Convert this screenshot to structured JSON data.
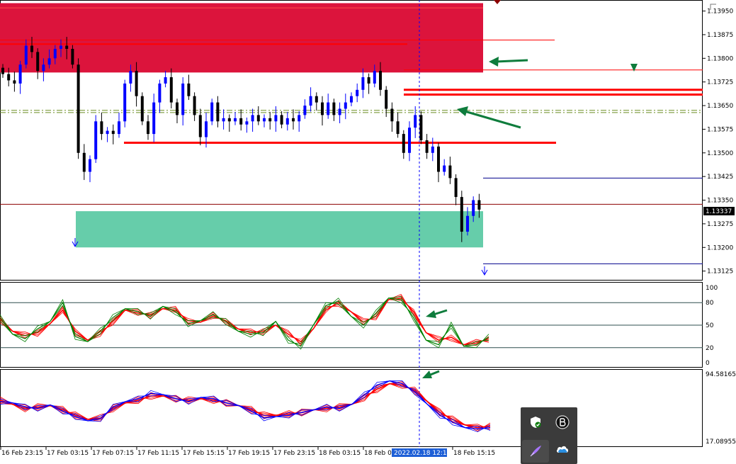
{
  "chart_data": [
    {
      "type": "candlestick",
      "title": "",
      "ylim": [
        1.13095,
        1.13985
      ],
      "yticks": [
        "1.13950",
        "1.13875",
        "1.13800",
        "1.13725",
        "1.13650",
        "1.13575",
        "1.13500",
        "1.13425",
        "1.13350",
        "1.13275",
        "1.13200",
        "1.13125"
      ],
      "current_price": "1.13337",
      "current_value": 1.13337,
      "zones": [
        {
          "name": "supply",
          "color": "#dc143c",
          "y1": 1.13755,
          "y2": 1.13975
        },
        {
          "name": "demand",
          "color": "#66cdaa",
          "y1": 1.132,
          "y2": 1.13315
        }
      ],
      "levels": [
        1.13532,
        1.137,
        1.13685,
        1.13763,
        1.13858,
        1.13635,
        1.13628,
        1.1342,
        1.13148,
        1.13337
      ],
      "close_path": [
        1.1375,
        1.1373,
        1.1372,
        1.1378,
        1.1384,
        1.1382,
        1.1376,
        1.1378,
        1.138,
        1.1383,
        1.1384,
        1.1383,
        1.1378,
        1.135,
        1.1344,
        1.1348,
        1.136,
        1.1356,
        1.1357,
        1.1356,
        1.136,
        1.1372,
        1.1376,
        1.1368,
        1.136,
        1.1356,
        1.1366,
        1.1372,
        1.1374,
        1.1366,
        1.1362,
        1.1372,
        1.1368,
        1.1362,
        1.1355,
        1.136,
        1.1366,
        1.136,
        1.1361,
        1.136,
        1.1361,
        1.1359,
        1.136,
        1.1362,
        1.136,
        1.1361,
        1.136,
        1.1362,
        1.1359,
        1.1361,
        1.136,
        1.1362,
        1.1365,
        1.1368,
        1.1366,
        1.1362,
        1.1366,
        1.1362,
        1.1364,
        1.1366,
        1.1368,
        1.137,
        1.1374,
        1.1372,
        1.1376,
        1.137,
        1.1364,
        1.136,
        1.1356,
        1.135,
        1.1358,
        1.1362,
        1.1354,
        1.135,
        1.1352,
        1.1344,
        1.1346,
        1.1342,
        1.1336,
        1.1325,
        1.133,
        1.1335,
        1.1332
      ]
    },
    {
      "type": "line",
      "title": "",
      "ylim": [
        0,
        100
      ],
      "yticks": [
        "100",
        "80",
        "50",
        "20",
        "0"
      ],
      "levels": [
        80,
        50,
        20
      ],
      "series": [
        {
          "color": "#ff0000",
          "values": [
            58,
            42,
            36,
            40,
            52,
            70,
            42,
            30,
            38,
            55,
            70,
            66,
            64,
            72,
            70,
            56,
            54,
            62,
            56,
            45,
            40,
            42,
            50,
            38,
            28,
            45,
            70,
            80,
            68,
            54,
            62,
            84,
            86,
            68,
            40,
            30,
            34,
            24,
            26,
            32
          ]
        },
        {
          "color": "#008000",
          "values": [
            60,
            38,
            32,
            45,
            55,
            80,
            35,
            28,
            42,
            60,
            72,
            68,
            62,
            75,
            68,
            52,
            56,
            64,
            55,
            42,
            38,
            40,
            55,
            30,
            22,
            50,
            76,
            82,
            62,
            50,
            66,
            86,
            84,
            60,
            30,
            24,
            50,
            22,
            24,
            34
          ]
        }
      ]
    },
    {
      "type": "line",
      "title": "",
      "ylim": [
        17.08955,
        94.58165
      ],
      "yticks": [
        "94.58165",
        "17.08955"
      ],
      "series": [
        {
          "color": "#0000ff",
          "values": [
            60,
            58,
            52,
            50,
            55,
            46,
            38,
            32,
            35,
            52,
            60,
            64,
            72,
            70,
            64,
            60,
            66,
            64,
            58,
            54,
            46,
            36,
            38,
            40,
            44,
            48,
            52,
            50,
            56,
            70,
            84,
            90,
            86,
            74,
            56,
            40,
            30,
            22,
            20,
            22
          ]
        },
        {
          "color": "#ff0000",
          "values": [
            62,
            56,
            50,
            52,
            54,
            48,
            40,
            34,
            36,
            50,
            58,
            62,
            68,
            68,
            64,
            62,
            64,
            62,
            58,
            54,
            48,
            40,
            40,
            42,
            44,
            48,
            50,
            52,
            56,
            66,
            78,
            86,
            84,
            76,
            60,
            44,
            34,
            26,
            22,
            24
          ]
        }
      ]
    }
  ],
  "xaxis": {
    "labels": [
      "16 Feb 23:15",
      "17 Feb 03:15",
      "17 Feb 07:15",
      "17 Feb 11:15",
      "17 Feb 15:15",
      "17 Feb 19:15",
      "17 Feb 23:15",
      "18 Feb 03:15",
      "18 Feb 07",
      "18 Feb 15:15"
    ],
    "cursor_label": "2022.02.18 12:15"
  },
  "colors": {
    "bull": "#0000ff",
    "bear": "#000000",
    "level": "#ff0000",
    "arrow": "#0e7c3c",
    "cursor": "#0000ff",
    "ma": "#6b8e23"
  },
  "tray": {
    "icons": [
      "shield-check-icon",
      "b-logo-icon",
      "pen-icon",
      "cloud-icon"
    ]
  }
}
